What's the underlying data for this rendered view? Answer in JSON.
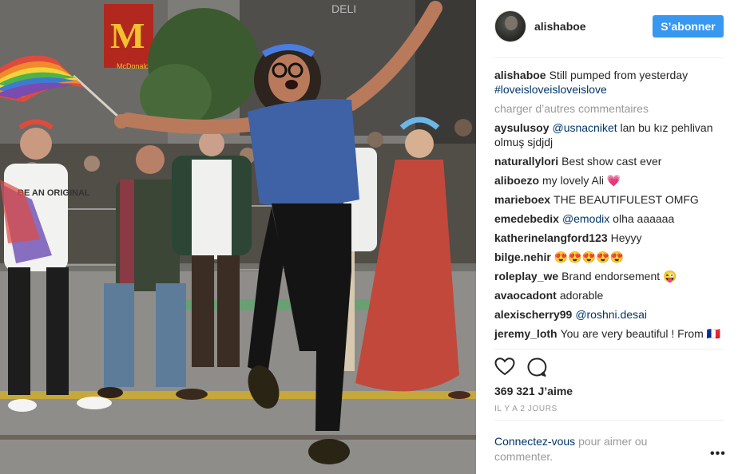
{
  "post": {
    "username": "alishaboe",
    "follow_label": "S’abonner",
    "caption": {
      "user": "alishaboe",
      "text": "Still pumped from yesterday",
      "hashtag": "#loveisloveisloveislove"
    },
    "load_more": "charger d’autres commentaires",
    "comments": [
      {
        "user": "aysulusoy",
        "mention": "@usnacniket",
        "text": "lan bu kız pehlivan olmuş sjdjdj"
      },
      {
        "user": "naturallylori",
        "mention": "",
        "text": "Best show cast ever"
      },
      {
        "user": "aliboezo",
        "mention": "",
        "text": "my lovely Ali 💗"
      },
      {
        "user": "marieboex",
        "mention": "",
        "text": "THE BEAUTIFULEST OMFG"
      },
      {
        "user": "emedebedix",
        "mention": "@emodix",
        "text": "olha aaaaaa"
      },
      {
        "user": "katherinelangford123",
        "mention": "",
        "text": "Heyyy"
      },
      {
        "user": "bilge.nehir",
        "mention": "",
        "text": "😍😍😍😍😍"
      },
      {
        "user": "roleplay_we",
        "mention": "",
        "text": "Brand endorsement 😜"
      },
      {
        "user": "avaocadont",
        "mention": "",
        "text": "adorable"
      },
      {
        "user": "alexischerry99",
        "mention": "@roshni.desai",
        "text": ""
      },
      {
        "user": "jeremy_loth",
        "mention": "",
        "text": "You are very beautiful ! From 🇫🇷"
      }
    ],
    "likes": "369 321 J’aime",
    "time": "IL Y A 2 JOURS",
    "login": {
      "link": "Connectez-vous",
      "text": "pour aimer ou commenter."
    },
    "more_label": "•••",
    "photo_signs": {
      "mcdonalds": "McDonald's",
      "deli": "DELI",
      "shirt": "BE AN ORIGINAL"
    }
  },
  "colors": {
    "follow": "#3897f0",
    "link": "#003569",
    "muted": "#999999"
  },
  "icons": [
    "heart-icon",
    "comment-icon",
    "more-options-icon"
  ]
}
